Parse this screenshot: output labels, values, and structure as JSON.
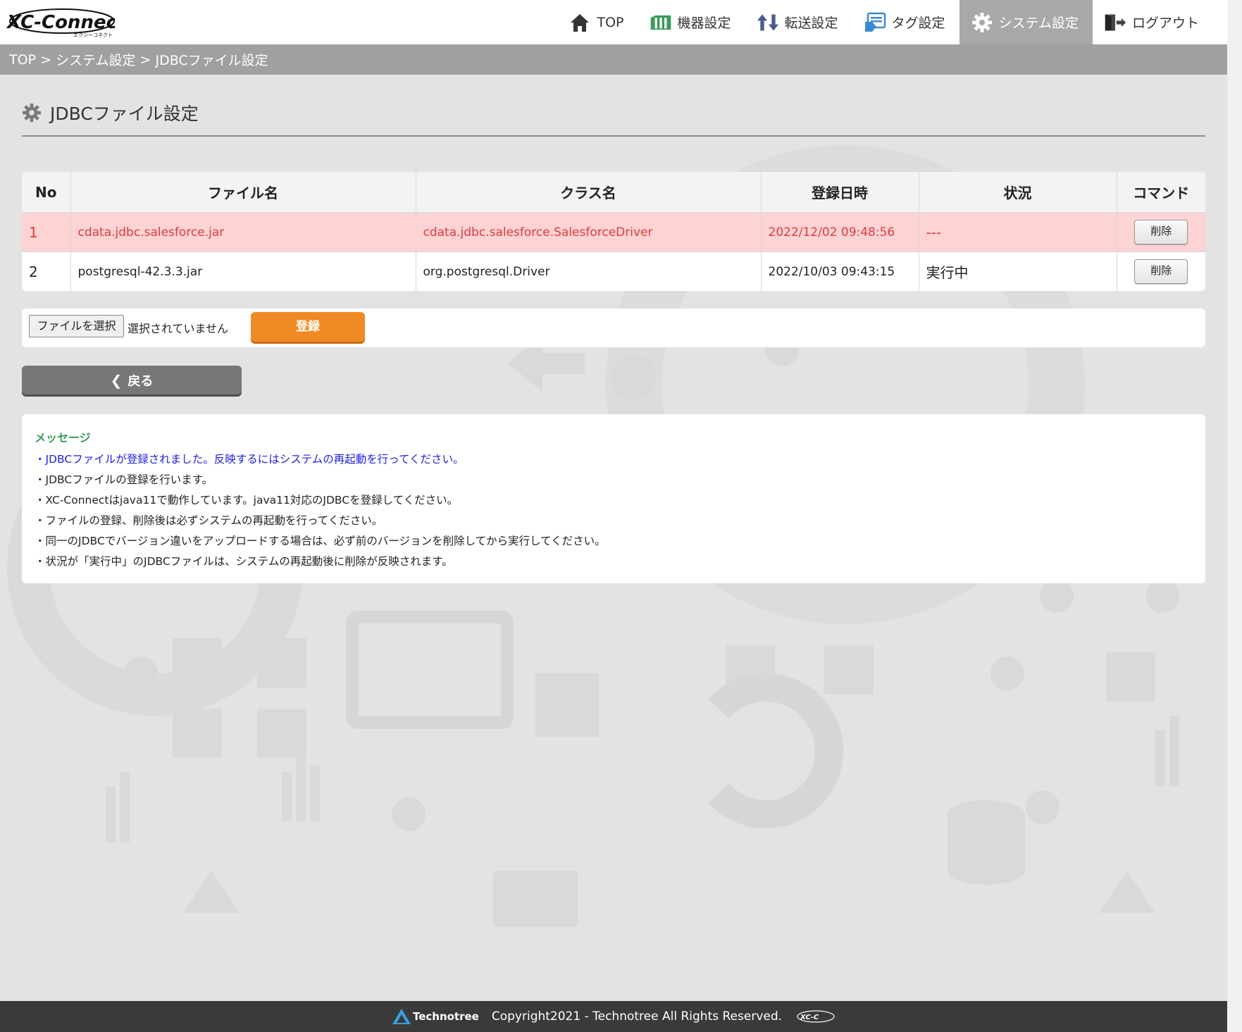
{
  "app": {
    "logo_text": "XC-Connect",
    "logo_subtext": "エクシーコネクト"
  },
  "nav": [
    {
      "label": "TOP",
      "icon": "home-icon",
      "color": "#333333"
    },
    {
      "label": "機器設定",
      "icon": "device-icon",
      "color": "#3a9a5b"
    },
    {
      "label": "転送設定",
      "icon": "transfer-icon",
      "color": "#4a5a8a"
    },
    {
      "label": "タグ設定",
      "icon": "tag-icon",
      "color": "#3a8ad0"
    },
    {
      "label": "システム設定",
      "icon": "gear-icon",
      "color": "#ffffff",
      "active": true
    },
    {
      "label": "ログアウト",
      "icon": "logout-icon",
      "color": "#444444"
    }
  ],
  "breadcrumb": [
    "TOP",
    "システム設定",
    "JDBCファイル設定"
  ],
  "breadcrumb_sep": " > ",
  "page_title": "JDBCファイル設定",
  "table": {
    "headers": [
      "No",
      "ファイル名",
      "クラス名",
      "登録日時",
      "状況",
      "コマンド"
    ],
    "rows": [
      {
        "no": "1",
        "file": "cdata.jdbc.salesforce.jar",
        "class": "cdata.jdbc.salesforce.SalesforceDriver",
        "date": "2022/12/02 09:48:56",
        "status": "---",
        "command": "削除",
        "highlight": true
      },
      {
        "no": "2",
        "file": "postgresql-42.3.3.jar",
        "class": "org.postgresql.Driver",
        "date": "2022/10/03 09:43:15",
        "status": "実行中",
        "command": "削除",
        "highlight": false
      }
    ]
  },
  "upload": {
    "choose_label": "ファイルを選択",
    "no_file_label": "選択されていません",
    "register_label": "登録"
  },
  "back_label": "戻る",
  "messages": {
    "title": "メッセージ",
    "items": [
      "・JDBCファイルが登録されました。反映するにはシステムの再起動を行ってください。",
      "・JDBCファイルの登録を行います。",
      "・XC-Connectはjava11で動作しています。java11対応のJDBCを登録してください。",
      "・ファイルの登録、削除後は必ずシステムの再起動を行ってください。",
      "・同一のJDBCでバージョン違いをアップロードする場合は、必ず前のバージョンを削除してから実行してください。",
      "・状況が「実行中」のJDBCファイルは、システムの再起動後に削除が反映されます。"
    ]
  },
  "footer": {
    "brand": "Technotree",
    "copyright": "Copyright2021 - Technotree All Rights Reserved."
  },
  "colors": {
    "accent_orange": "#f08a24",
    "error_row_bg": "#fdd3d4",
    "error_text": "#e03a3a",
    "info_text": "#1f1fe0",
    "message_title": "#3a9a5b"
  }
}
